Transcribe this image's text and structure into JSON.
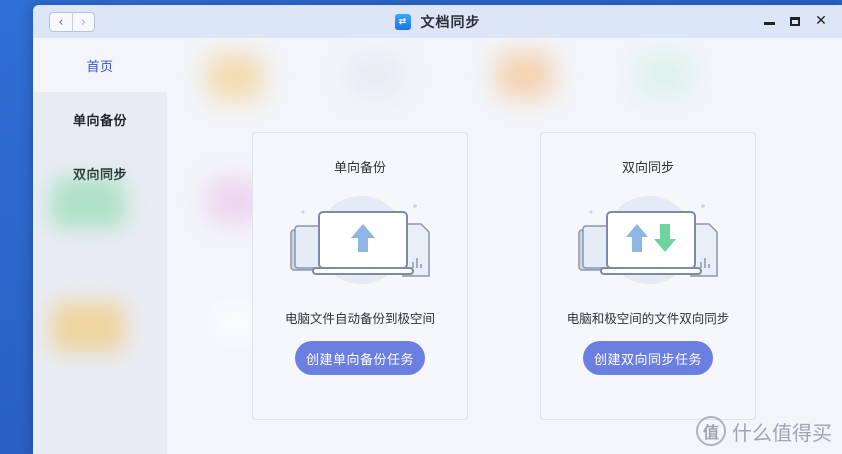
{
  "window": {
    "title": "文档同步",
    "app_icon_glyph": "⇄",
    "back_glyph": "‹",
    "forward_glyph": "›",
    "close_glyph": "✕"
  },
  "sidebar": {
    "items": [
      {
        "label": "首页",
        "active": true
      },
      {
        "label": "单向备份",
        "active": false
      },
      {
        "label": "双向同步",
        "active": false
      }
    ]
  },
  "cards": [
    {
      "title": "单向备份",
      "description": "电脑文件自动备份到极空间",
      "button": "创建单向备份任务",
      "icon": "upload-arrow-icon"
    },
    {
      "title": "双向同步",
      "description": "电脑和极空间的文件双向同步",
      "button": "创建双向同步任务",
      "icon": "sync-arrows-icon"
    }
  ],
  "watermark": {
    "glyph": "值",
    "text": "什么值得买"
  },
  "colors": {
    "accent": "#3454d1",
    "button": "#6a7fe0",
    "upload_arrow": "#8fb4e6",
    "download_arrow": "#6fd3a0"
  }
}
